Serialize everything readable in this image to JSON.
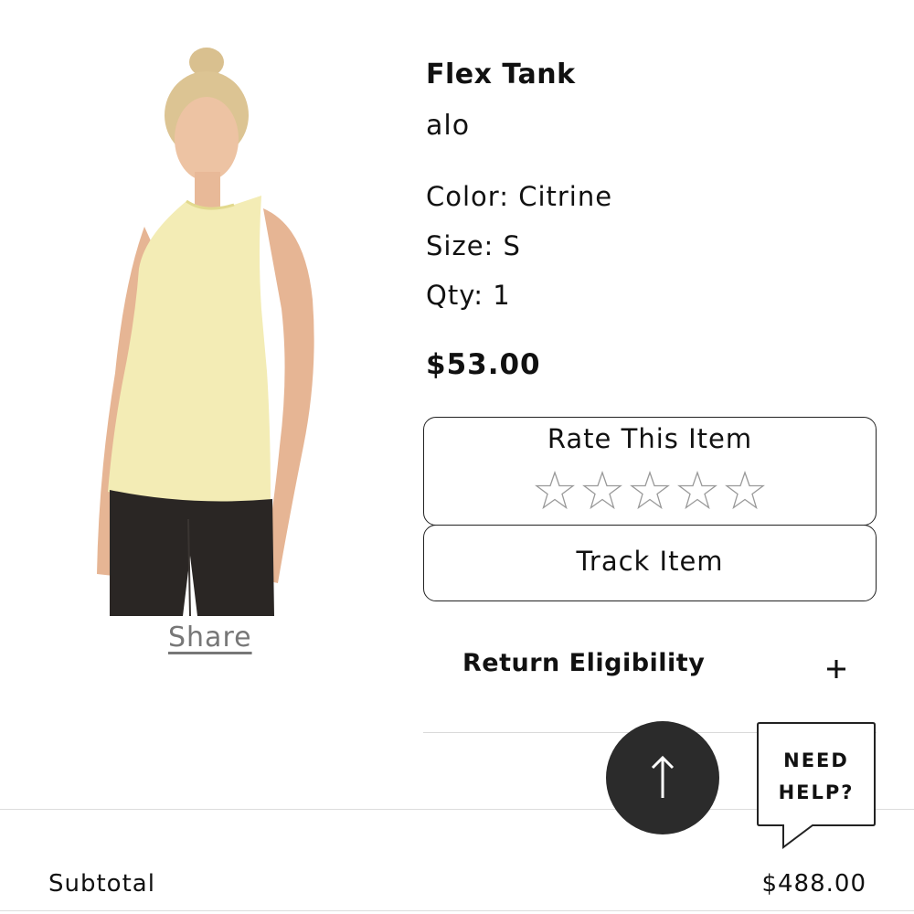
{
  "product": {
    "title": "Flex Tank",
    "brand": "alo",
    "color": "Color: Citrine",
    "size": "Size: S",
    "qty": "Qty: 1",
    "price": "$53.00",
    "image_colors": {
      "tank": "#f3ecb5",
      "leggings": "#2a2624",
      "skin": "#e8b998",
      "hair": "#d9c08f"
    }
  },
  "share_label": "Share",
  "rate": {
    "label": "Rate This Item",
    "max_stars": 5,
    "selected": 0
  },
  "track_label": "Track Item",
  "return": {
    "label": "Return Eligibility"
  },
  "help": {
    "line1": "NEED",
    "line2": "HELP?"
  },
  "subtotal": {
    "label": "Subtotal",
    "value": "$488.00"
  }
}
